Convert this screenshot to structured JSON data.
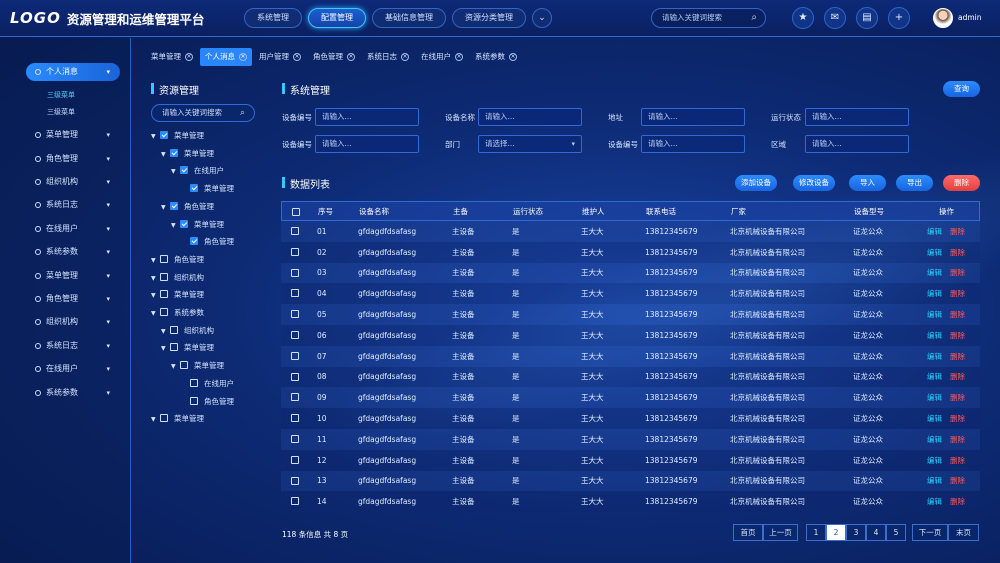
{
  "header": {
    "logo": "LOGO",
    "title": "资源管理和运维管理平台",
    "nav": [
      {
        "label": "系统管理",
        "active": false
      },
      {
        "label": "配置管理",
        "active": true
      },
      {
        "label": "基础信息管理",
        "active": false
      },
      {
        "label": "资源分类管理",
        "active": false
      }
    ],
    "more_icon": "chevron-down-icon",
    "search_placeholder": "请输入关键词搜索",
    "icons": [
      "star-icon",
      "mail-icon",
      "message-icon",
      "plus-icon"
    ],
    "username": "admin"
  },
  "sidebar": {
    "items": [
      {
        "label": "个人消息",
        "active": true,
        "sub": [
          {
            "label": "三级菜单",
            "active": true
          },
          {
            "label": "三级菜单",
            "active": false
          }
        ]
      },
      {
        "label": "菜单管理"
      },
      {
        "label": "角色管理"
      },
      {
        "label": "组织机构"
      },
      {
        "label": "系统日志"
      },
      {
        "label": "在线用户"
      },
      {
        "label": "系统参数"
      },
      {
        "label": "菜单管理"
      },
      {
        "label": "角色管理"
      },
      {
        "label": "组织机构"
      },
      {
        "label": "系统日志"
      },
      {
        "label": "在线用户"
      },
      {
        "label": "系统参数"
      }
    ]
  },
  "tabs": [
    {
      "label": "菜单管理",
      "active": false
    },
    {
      "label": "个人消息",
      "active": true
    },
    {
      "label": "用户管理",
      "active": false
    },
    {
      "label": "角色管理",
      "active": false
    },
    {
      "label": "系统日志",
      "active": false
    },
    {
      "label": "在线用户",
      "active": false
    },
    {
      "label": "系统参数",
      "active": false
    }
  ],
  "tree": {
    "title": "资源管理",
    "search_placeholder": "请输入关键词搜索",
    "nodes": [
      {
        "label": "菜单管理",
        "level": 0,
        "arrow": true,
        "checked": true
      },
      {
        "label": "菜单管理",
        "level": 1,
        "arrow": true,
        "checked": true
      },
      {
        "label": "在线用户",
        "level": 2,
        "arrow": true,
        "checked": true
      },
      {
        "label": "菜单管理",
        "level": 3,
        "arrow": false,
        "checked": true
      },
      {
        "label": "角色管理",
        "level": 1,
        "arrow": true,
        "checked": true
      },
      {
        "label": "菜单管理",
        "level": 2,
        "arrow": true,
        "checked": true
      },
      {
        "label": "角色管理",
        "level": 3,
        "arrow": false,
        "checked": true
      },
      {
        "label": "角色管理",
        "level": 0,
        "arrow": true,
        "checked": false
      },
      {
        "label": "组织机构",
        "level": 0,
        "arrow": true,
        "checked": false
      },
      {
        "label": "菜单管理",
        "level": 0,
        "arrow": true,
        "checked": false
      },
      {
        "label": "系统参数",
        "level": 0,
        "arrow": true,
        "checked": false
      },
      {
        "label": "组织机构",
        "level": 1,
        "arrow": true,
        "checked": false
      },
      {
        "label": "菜单管理",
        "level": 1,
        "arrow": true,
        "checked": false
      },
      {
        "label": "菜单管理",
        "level": 2,
        "arrow": true,
        "checked": false
      },
      {
        "label": "在线用户",
        "level": 3,
        "arrow": false,
        "checked": false
      },
      {
        "label": "角色管理",
        "level": 3,
        "arrow": false,
        "checked": false
      },
      {
        "label": "菜单管理",
        "level": 0,
        "arrow": true,
        "checked": false
      }
    ]
  },
  "filter": {
    "title": "系统管理",
    "query_button": "查询",
    "fields": [
      {
        "label": "设备编号",
        "placeholder": "请输入..."
      },
      {
        "label": "设备名称",
        "placeholder": "请输入..."
      },
      {
        "label": "地址",
        "placeholder": "请输入..."
      },
      {
        "label": "运行状态",
        "placeholder": "请输入..."
      },
      {
        "label": "设备编号",
        "placeholder": "请输入..."
      },
      {
        "label": "部门",
        "placeholder": "请选择...",
        "select": true
      },
      {
        "label": "设备编号",
        "placeholder": "请输入..."
      },
      {
        "label": "区域",
        "placeholder": "请输入..."
      }
    ]
  },
  "list": {
    "title": "数据列表",
    "buttons": [
      {
        "label": "添加设备",
        "danger": false
      },
      {
        "label": "修改设备",
        "danger": false
      },
      {
        "label": "导入",
        "danger": false
      },
      {
        "label": "导出",
        "danger": false
      },
      {
        "label": "删除",
        "danger": true
      }
    ],
    "columns": [
      "序号",
      "设备名称",
      "主备",
      "运行状态",
      "维护人",
      "联系电话",
      "厂家",
      "设备型号",
      "操作"
    ],
    "rows": [
      [
        "01",
        "gfdagdfdsafasg",
        "主设备",
        "是",
        "王大大",
        "13812345679",
        "北京机械设备有限公司",
        "证龙公众"
      ],
      [
        "02",
        "gfdagdfdsafasg",
        "主设备",
        "是",
        "王大大",
        "13812345679",
        "北京机械设备有限公司",
        "证龙公众"
      ],
      [
        "03",
        "gfdagdfdsafasg",
        "主设备",
        "是",
        "王大大",
        "13812345679",
        "北京机械设备有限公司",
        "证龙公众"
      ],
      [
        "04",
        "gfdagdfdsafasg",
        "主设备",
        "是",
        "王大大",
        "13812345679",
        "北京机械设备有限公司",
        "证龙公众"
      ],
      [
        "05",
        "gfdagdfdsafasg",
        "主设备",
        "是",
        "王大大",
        "13812345679",
        "北京机械设备有限公司",
        "证龙公众"
      ],
      [
        "06",
        "gfdagdfdsafasg",
        "主设备",
        "是",
        "王大大",
        "13812345679",
        "北京机械设备有限公司",
        "证龙公众"
      ],
      [
        "07",
        "gfdagdfdsafasg",
        "主设备",
        "是",
        "王大大",
        "13812345679",
        "北京机械设备有限公司",
        "证龙公众"
      ],
      [
        "08",
        "gfdagdfdsafasg",
        "主设备",
        "是",
        "王大大",
        "13812345679",
        "北京机械设备有限公司",
        "证龙公众"
      ],
      [
        "09",
        "gfdagdfdsafasg",
        "主设备",
        "是",
        "王大大",
        "13812345679",
        "北京机械设备有限公司",
        "证龙公众"
      ],
      [
        "10",
        "gfdagdfdsafasg",
        "主设备",
        "是",
        "王大大",
        "13812345679",
        "北京机械设备有限公司",
        "证龙公众"
      ],
      [
        "11",
        "gfdagdfdsafasg",
        "主设备",
        "是",
        "王大大",
        "13812345679",
        "北京机械设备有限公司",
        "证龙公众"
      ],
      [
        "12",
        "gfdagdfdsafasg",
        "主设备",
        "是",
        "王大大",
        "13812345679",
        "北京机械设备有限公司",
        "证龙公众"
      ],
      [
        "13",
        "gfdagdfdsafasg",
        "主设备",
        "是",
        "王大大",
        "13812345679",
        "北京机械设备有限公司",
        "证龙公众"
      ],
      [
        "14",
        "gfdagdfdsafasg",
        "主设备",
        "是",
        "王大大",
        "13812345679",
        "北京机械设备有限公司",
        "证龙公众"
      ]
    ],
    "edit_label": "编辑",
    "delete_label": "删除"
  },
  "pagination": {
    "summary": "118 条信息 共 8 页",
    "first": "首页",
    "prev": "上一页",
    "pages": [
      "1",
      "2",
      "3",
      "4",
      "5"
    ],
    "current": "2",
    "next": "下一页",
    "last": "末页"
  },
  "colors": {
    "accent": "#2a8cff",
    "cyan": "#39c6ff",
    "danger": "#ff5b5b",
    "bg": "#0d2a74"
  }
}
